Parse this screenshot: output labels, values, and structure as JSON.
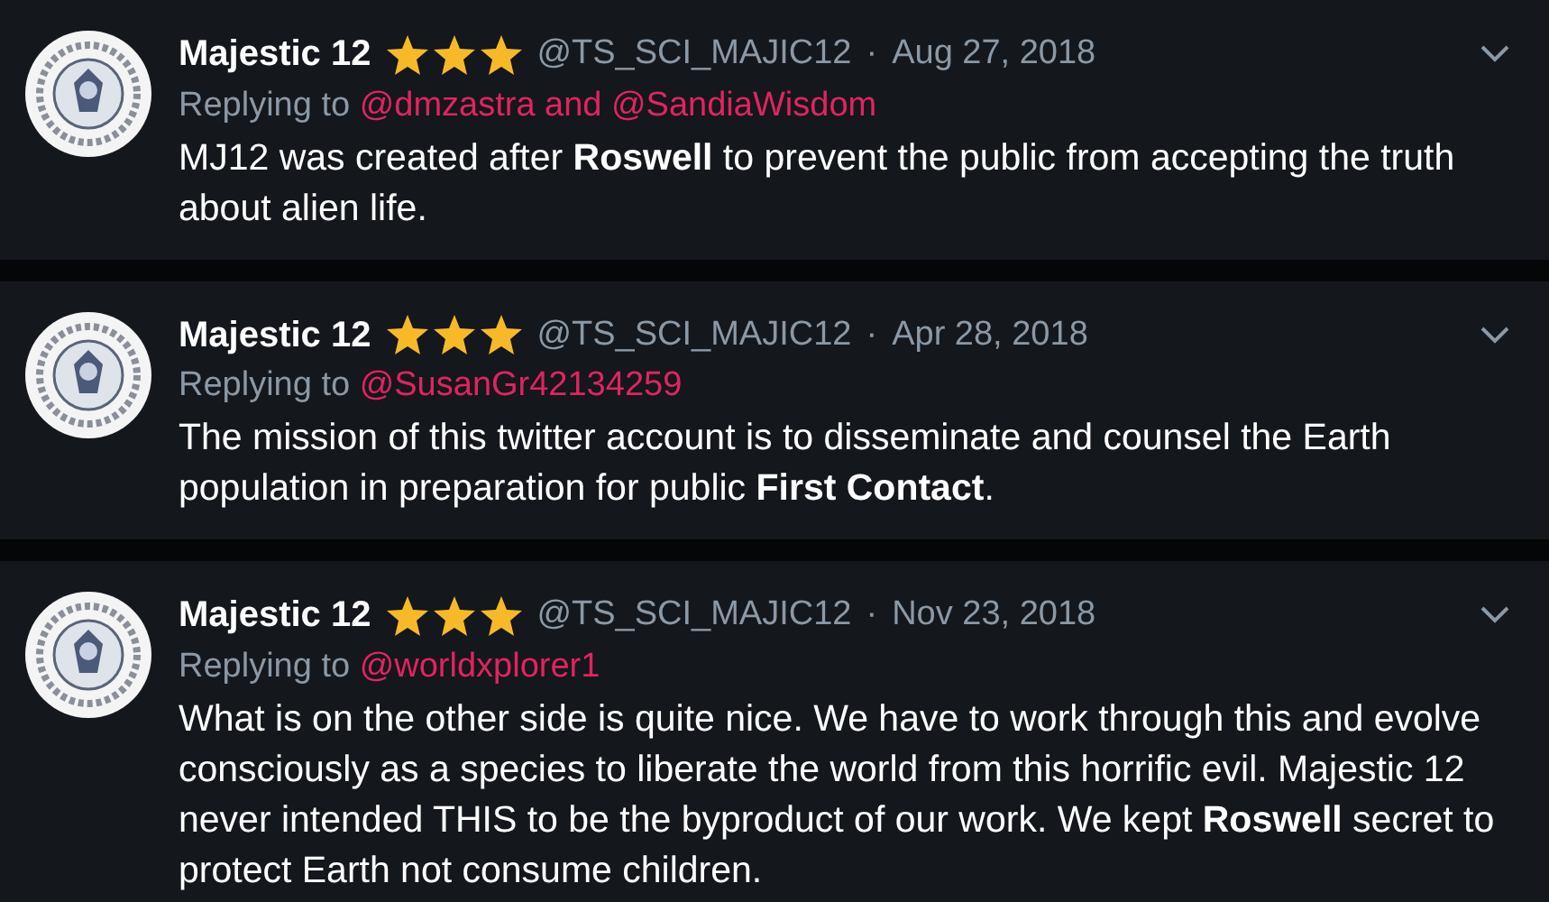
{
  "separator": "·",
  "tweets": [
    {
      "name": "Majestic 12",
      "stars": 3,
      "handle": "@TS_SCI_MAJIC12",
      "date": "Aug 27, 2018",
      "replying_label": "Replying to",
      "replying_to": "@dmzastra and @SandiaWisdom",
      "text": "MJ12 was created after **Roswell** to prevent the public from accepting the truth about alien life."
    },
    {
      "name": "Majestic 12",
      "stars": 3,
      "handle": "@TS_SCI_MAJIC12",
      "date": "Apr 28, 2018",
      "replying_label": "Replying to",
      "replying_to": "@SusanGr42134259",
      "text": "The mission of this twitter account is to disseminate and counsel the Earth population in preparation for public **First Contact**."
    },
    {
      "name": "Majestic 12",
      "stars": 3,
      "handle": "@TS_SCI_MAJIC12",
      "date": "Nov 23, 2018",
      "replying_label": "Replying to",
      "replying_to": "@worldxplorer1",
      "text": "What is on the other side is quite nice. We have to work through this and evolve consciously as a species to liberate the world from this horrific evil. Majestic 12 never intended THIS to be the byproduct of our work. We kept **Roswell** secret to protect Earth not consume children."
    }
  ]
}
